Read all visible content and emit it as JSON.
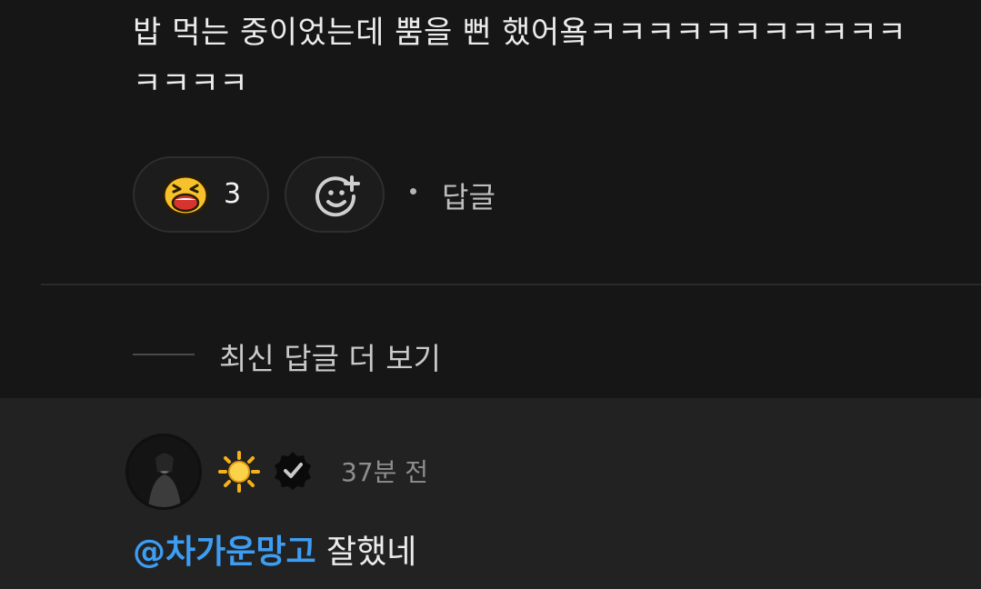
{
  "comment": {
    "text": "밥 먹는 중이었는데 뿜을 뻔 했어욬ㅋㅋㅋㅋㅋㅋㅋㅋㅋㅋㅋㅋㅋㅋㅋ",
    "reaction": {
      "icon": "laughing-face-icon",
      "count": "3"
    },
    "add_reaction_icon": "add-emoji-icon",
    "separator": "·",
    "reply_label": "답글"
  },
  "more_replies_label": "최신 답글 더 보기",
  "reply": {
    "avatar_icon": "user-avatar",
    "badges": [
      "sun-icon",
      "verified-icon"
    ],
    "timestamp": "37분 전",
    "mention": "@차가운망고",
    "text": " 잘했네"
  },
  "colors": {
    "background": "#161616",
    "reply_background": "#222222",
    "mention": "#3d9df2"
  }
}
